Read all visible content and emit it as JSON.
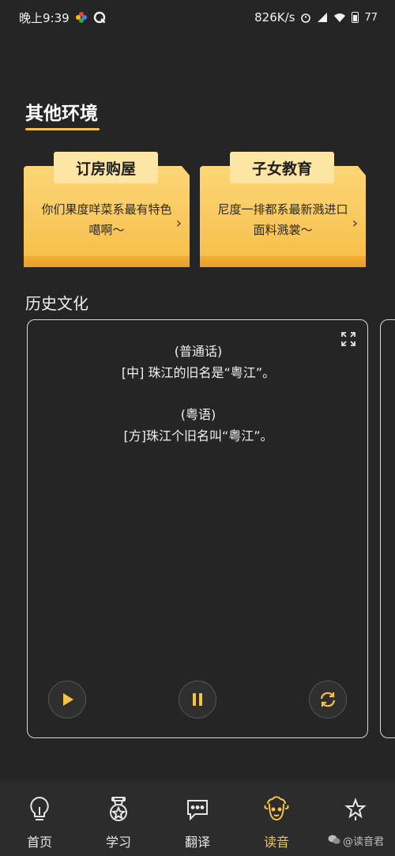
{
  "status_bar": {
    "time": "晚上9:39",
    "net_speed": "826K/s",
    "battery": "77"
  },
  "section": {
    "title": "其他环境"
  },
  "folders": [
    {
      "tab": "订房购屋",
      "text": "你们果度咩菜系最有特色噶啊～",
      "chevron": "›"
    },
    {
      "tab": "子女教育",
      "text": "尼度一排都系最新溅进口面料溅裳～",
      "chevron": "›"
    }
  ],
  "history": {
    "title": "历史文化",
    "mandarin_label": "(普通话)",
    "mandarin_text": "[中] 珠江的旧名是“粤江”。",
    "cantonese_label": "(粤语)",
    "cantonese_text": "[方]珠江个旧名叫“粤江”。"
  },
  "bottom_nav": [
    {
      "label": "首页",
      "icon": "lightbulb-icon"
    },
    {
      "label": "学习",
      "icon": "medal-icon"
    },
    {
      "label": "翻译",
      "icon": "chat-bubble-icon"
    },
    {
      "label": "读音",
      "icon": "sheep-icon",
      "active": true
    },
    {
      "label": "",
      "icon": "star-sparkle-icon"
    }
  ],
  "watermark": "@读音君",
  "colors": {
    "accent": "#f5c445",
    "background": "#252525",
    "nav_background": "#2c2c2c",
    "folder_gradient_top": "#fbd676",
    "folder_gradient_bottom": "#f7bd48"
  }
}
